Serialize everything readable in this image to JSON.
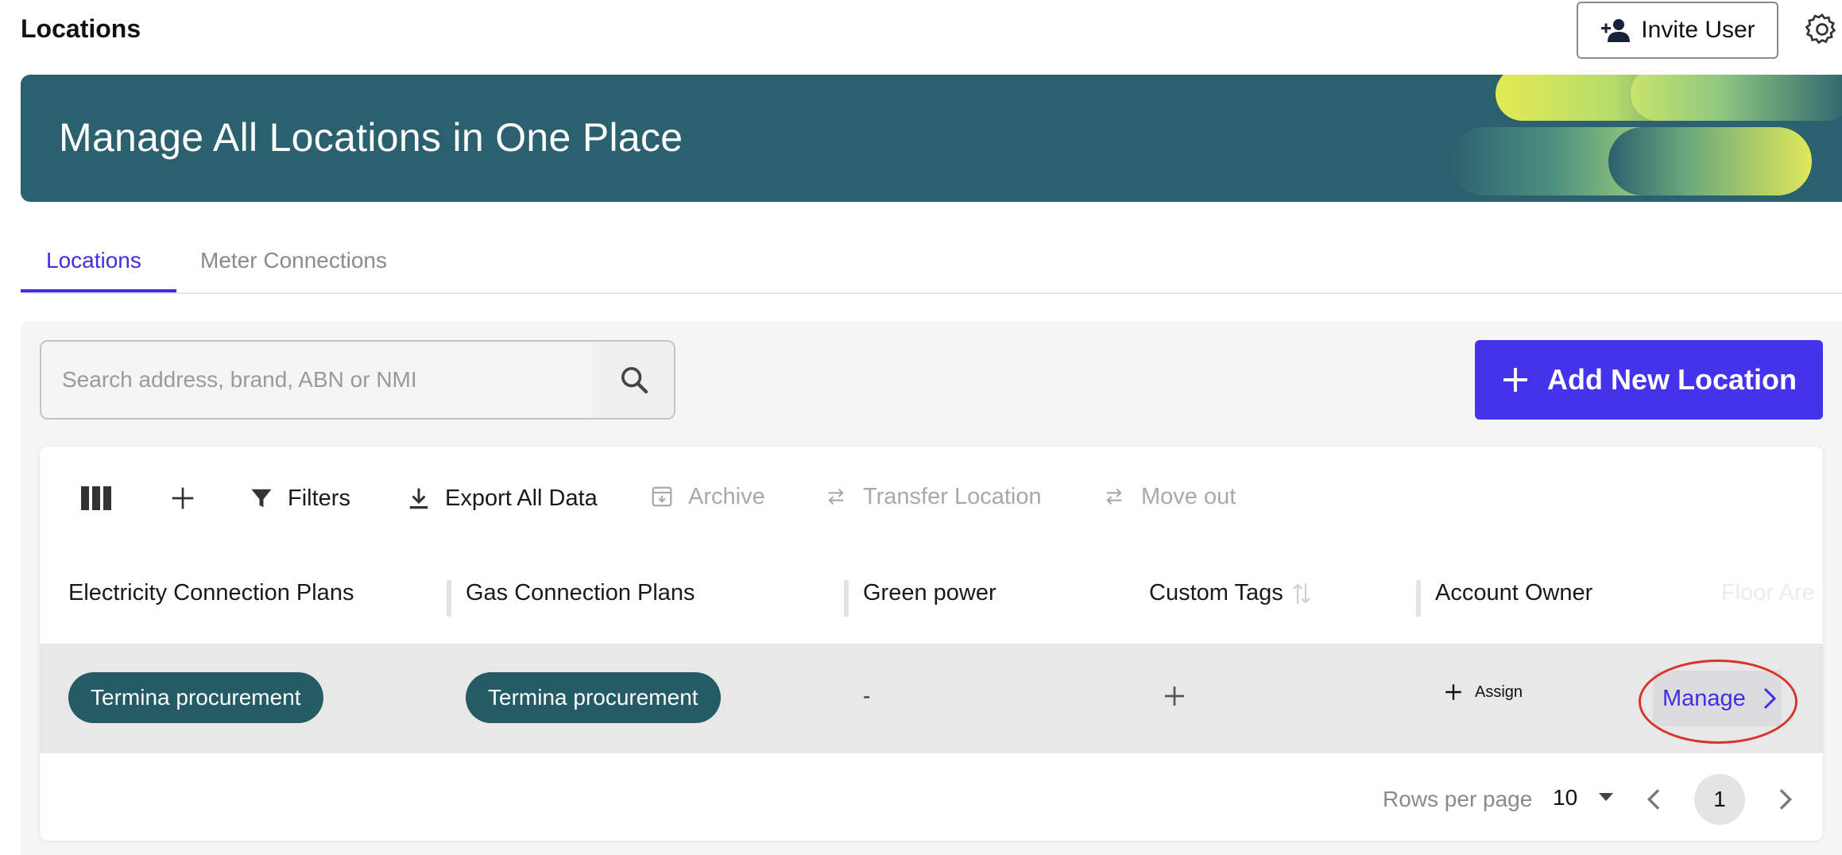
{
  "header": {
    "title": "Locations",
    "invite_label": "Invite User"
  },
  "banner": {
    "title": "Manage All Locations in One Place"
  },
  "tabs": [
    {
      "label": "Locations",
      "active": true
    },
    {
      "label": "Meter Connections",
      "active": false
    }
  ],
  "search": {
    "placeholder": "Search address, brand, ABN or NMI",
    "value": ""
  },
  "add_button": {
    "label": "Add New Location"
  },
  "toolbar": {
    "filters_label": "Filters",
    "export_label": "Export All Data",
    "archive_label": "Archive",
    "transfer_label": "Transfer Location",
    "moveout_label": "Move out"
  },
  "table": {
    "columns": [
      "Electricity Connection Plans",
      "Gas Connection Plans",
      "Green power",
      "Custom Tags",
      "Account Owner",
      "Floor Are"
    ],
    "rows": [
      {
        "electricity_plan": "Termina procurement",
        "gas_plan": "Termina procurement",
        "green_power": "-",
        "assign_label": "Assign",
        "manage_label": "Manage"
      }
    ]
  },
  "pagination": {
    "rows_per_page_label": "Rows per page",
    "rows_per_page_value": "10",
    "current_page": "1"
  },
  "colors": {
    "primary": "#4433ea",
    "banner_bg": "#2b616e",
    "chip_bg": "#245b65",
    "highlight_ring": "#d9342b"
  }
}
